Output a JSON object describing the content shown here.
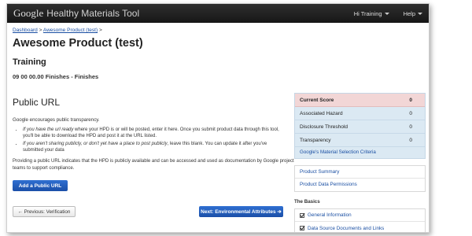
{
  "app": {
    "brand": "Google",
    "title": "Healthy Materials Tool"
  },
  "nav": [
    {
      "label": "Hi Training"
    },
    {
      "label": "Help"
    }
  ],
  "breadcrumb": {
    "dashboard": "Dashboard",
    "sep1": ">",
    "product": "Awesome Product (test)",
    "sep2": ">"
  },
  "page": {
    "title": "Awesome Product (test)",
    "section": "Training",
    "product_id": "09 00 00.00 Finishes - Finishes"
  },
  "public_url": {
    "title": "Public URL",
    "intro": "Google encourages public transparency.",
    "bullet1_em": "If you have the url ready",
    "bullet1_rest": " where your HPD is or will be posted, enter it here. Once you submit product data through this tool, you'll be able to download the HPD and post it at the URL listed.",
    "bullet2_em": "If you aren't sharing publicly, or don't yet have a place to post publicly",
    "bullet2_rest": ", leave this blank. You can update it after you've submitted your data",
    "note": "Providing a public URL indicates that the HPD is publicly available and can be accessed and used as documentation by Google project teams to support compliance.",
    "add_button": "Add a Public URL"
  },
  "footer_nav": {
    "prev": "← Previous: Verification",
    "next": "Next: Environmental Attributes ➔"
  },
  "score_panel": {
    "rows": [
      {
        "label": "Current Score",
        "value": "0"
      },
      {
        "label": "Associated Hazard",
        "value": "0"
      },
      {
        "label": "Disclosure Threshold",
        "value": "0"
      },
      {
        "label": "Transparency",
        "value": "0"
      }
    ],
    "criteria_link": "Google's Material Selection Criteria"
  },
  "product_links": [
    {
      "label": "Product Summary"
    },
    {
      "label": "Product Data Permissions"
    }
  ],
  "basics": {
    "heading": "The Basics",
    "items": [
      {
        "label": "General Information"
      },
      {
        "label": "Data Source Documents and Links"
      }
    ]
  }
}
